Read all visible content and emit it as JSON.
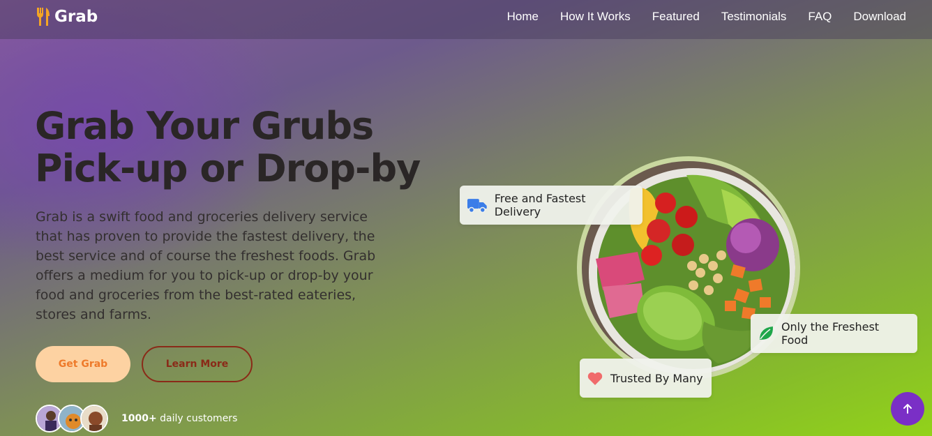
{
  "brand": {
    "name": "Grab",
    "icon": "fork-knife-icon",
    "color": "#f5a524"
  },
  "nav": {
    "items": [
      "Home",
      "How It Works",
      "Featured",
      "Testimonials",
      "FAQ",
      "Download"
    ]
  },
  "hero": {
    "title_line1": "Grab Your Grubs",
    "title_line2": "Pick-up or Drop-by",
    "description": "Grab is a swift food and groceries delivery service that has proven to provide the fastest delivery, the best service and of course the freshest foods. Grab offers a medium for you to pick-up or drop-by your food and groceries from the best-rated eateries, stores and farms.",
    "primary_button": "Get Grab",
    "secondary_button": "Learn More"
  },
  "customers": {
    "count": "1000+",
    "label": "daily customers"
  },
  "badges": {
    "delivery": {
      "label": "Free and Fastest Delivery",
      "icon": "truck-icon",
      "color": "#3b7de8"
    },
    "fresh": {
      "label": "Only the Freshest Food",
      "icon": "leaf-icon",
      "color": "#1fa64a"
    },
    "trusted": {
      "label": "Trusted By Many",
      "icon": "heart-icon",
      "color": "#f06b6b"
    }
  },
  "scroll_top": {
    "icon": "arrow-up-icon",
    "color": "#7a2fc6"
  }
}
